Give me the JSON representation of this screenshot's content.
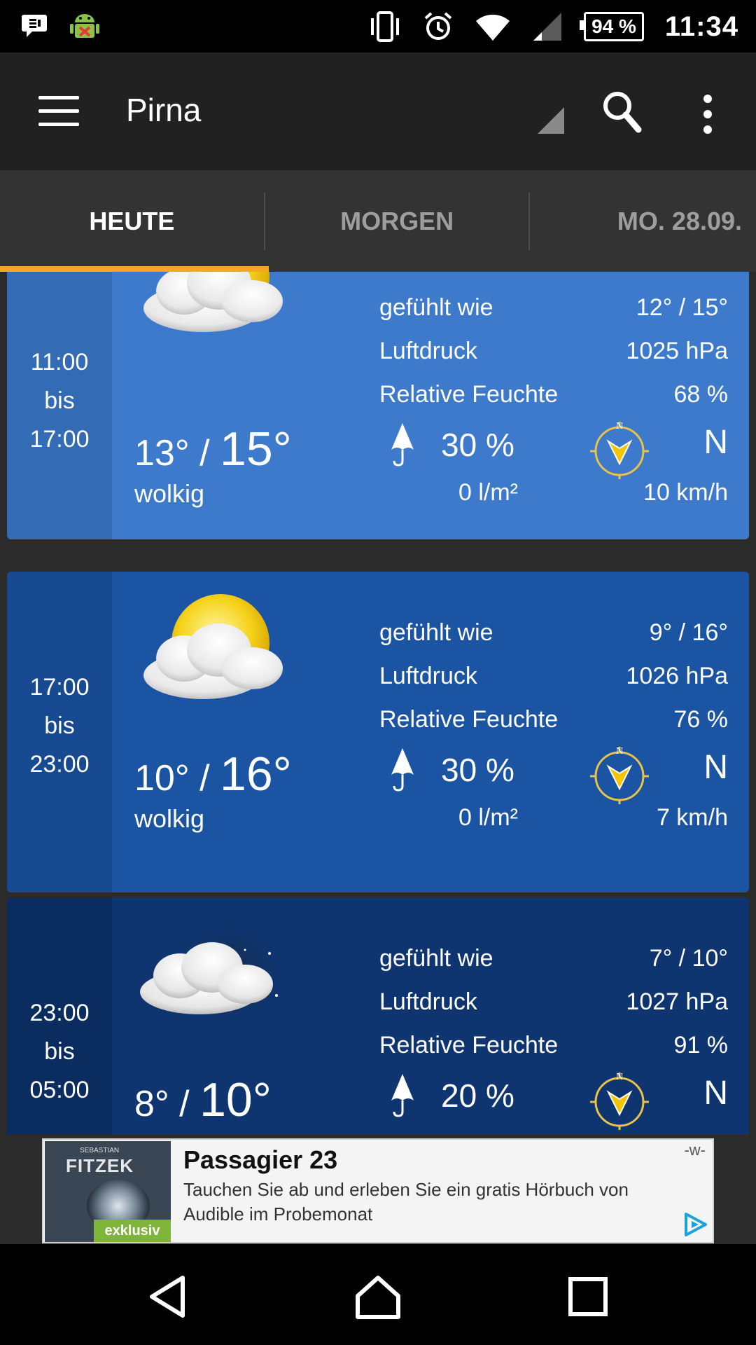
{
  "status_bar": {
    "time": "11:34",
    "battery": "94 %",
    "left_icons": [
      "message-icon",
      "android-debug-icon"
    ],
    "right_icons": [
      "vibrate-icon",
      "alarm-icon",
      "wifi-icon",
      "signal-icon"
    ]
  },
  "app_bar": {
    "city": "Pirna"
  },
  "tabs": [
    {
      "label": "HEUTE",
      "active": true
    },
    {
      "label": "MORGEN",
      "active": false
    },
    {
      "label": "MO. 28.09.",
      "active": false
    }
  ],
  "periods": [
    {
      "from": "11:00",
      "bis": "bis",
      "to": "17:00",
      "temp_low": "13°",
      "sep": "/",
      "temp_high": "15°",
      "condition": "wolkig",
      "icon": "partly-cloudy-sun-icon",
      "felt_label": "gefühlt wie",
      "felt_value": "12° / 15°",
      "pressure_label": "Luftdruck",
      "pressure_value": "1025 hPa",
      "humidity_label": "Relative Feuchte",
      "humidity_value": "68 %",
      "rain_prob": "30 %",
      "rain_amount": "0 l/m²",
      "wind_dir": "N",
      "wind_speed": "10 km/h",
      "bg": "#3d7acb",
      "time_bg": "#336bb5"
    },
    {
      "from": "17:00",
      "bis": "bis",
      "to": "23:00",
      "temp_low": "10°",
      "sep": "/",
      "temp_high": "16°",
      "condition": "wolkig",
      "icon": "partly-cloudy-sun-icon",
      "felt_label": "gefühlt wie",
      "felt_value": "9° / 16°",
      "pressure_label": "Luftdruck",
      "pressure_value": "1026 hPa",
      "humidity_label": "Relative Feuchte",
      "humidity_value": "76 %",
      "rain_prob": "30 %",
      "rain_amount": "0 l/m²",
      "wind_dir": "N",
      "wind_speed": "7 km/h",
      "bg": "#1b54a3",
      "time_bg": "#174a90"
    },
    {
      "from": "23:00",
      "bis": "bis",
      "to": "05:00",
      "temp_low": "8°",
      "sep": "/",
      "temp_high": "10°",
      "condition": "",
      "icon": "partly-cloudy-moon-icon",
      "felt_label": "gefühlt wie",
      "felt_value": "7° / 10°",
      "pressure_label": "Luftdruck",
      "pressure_value": "1027 hPa",
      "humidity_label": "Relative Feuchte",
      "humidity_value": "91 %",
      "rain_prob": "20 %",
      "rain_amount": "",
      "wind_dir": "N",
      "wind_speed": "",
      "bg": "#0e3570",
      "time_bg": "#0b2c5e"
    }
  ],
  "ad": {
    "image_author_pre": "SEBASTIAN",
    "image_author": "FITZEK",
    "image_ribbon": "exklusiv",
    "title": "Passagier 23",
    "text": "Tauchen Sie ab und erleben Sie ein gratis Hörbuch von Audible im Probemonat",
    "marker": "-w-"
  },
  "nav_bar": {
    "buttons": [
      "back-icon",
      "home-icon",
      "recents-icon"
    ]
  }
}
